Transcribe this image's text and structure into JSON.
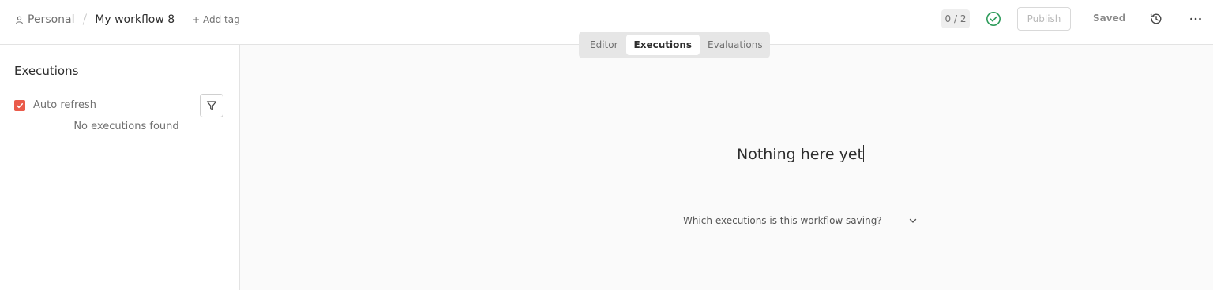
{
  "header": {
    "project_label": "Personal",
    "separator": "/",
    "workflow_title": "My workflow 8",
    "add_tag_label": "+ Add tag",
    "counter": "0 / 2",
    "publish_label": "Publish",
    "saved_label": "Saved",
    "icons": {
      "project": "user-icon",
      "status": "check-circle-icon",
      "history": "history-icon",
      "more": "ellipsis-icon"
    }
  },
  "tabs": [
    {
      "label": "Editor",
      "active": false
    },
    {
      "label": "Executions",
      "active": true
    },
    {
      "label": "Evaluations",
      "active": false
    }
  ],
  "sidebar": {
    "title": "Executions",
    "auto_refresh_label": "Auto refresh",
    "auto_refresh_checked": true,
    "filter_icon": "filter-icon",
    "empty_text": "No executions found"
  },
  "main": {
    "empty_title": "Nothing here yet",
    "saving_question": "Which executions is this workflow saving?",
    "expand_icon": "chevron-down-icon"
  },
  "colors": {
    "accent": "#ea5b4b",
    "success": "#2d9b5a",
    "text": "#2d2d2d",
    "muted": "#707070",
    "border": "#e3e3e3"
  }
}
